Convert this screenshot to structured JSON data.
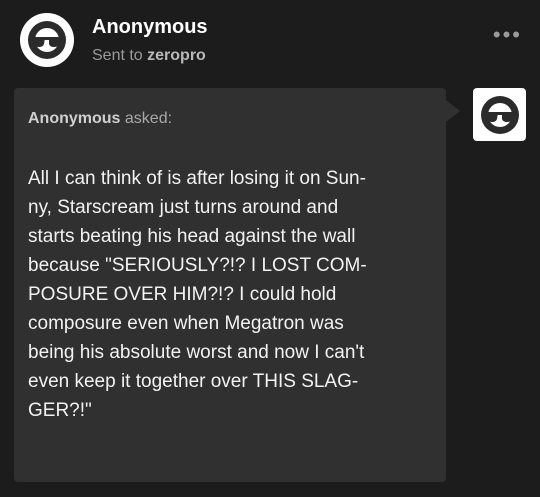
{
  "post": {
    "author": "Anonymous",
    "sent_to_prefix": "Sent to",
    "recipient": "zeropro",
    "more_label": "•••"
  },
  "ask": {
    "asker": "Anonymous",
    "asked_suffix": "asked:",
    "question_lines": [
      "All I can think of is after losing it on Sun-",
      "ny, Starscream just turns around and",
      "starts beating his head against the wall",
      "because \"SERIOUSLY?!? I LOST COM-",
      "POSURE OVER HIM?!? I could hold",
      "composure even when Megatron was",
      "being his absolute worst and now I can't",
      "even keep it together over THIS SLAG-",
      "GER?!\""
    ]
  },
  "icons": {
    "avatar": "anonymous-sunglasses-icon",
    "more": "more-options-icon"
  },
  "colors": {
    "background": "#1c1c1c",
    "bubble": "#303030",
    "secondary_text": "#9a9a9a"
  }
}
